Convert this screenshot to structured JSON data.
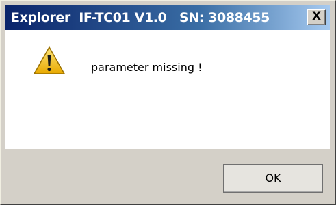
{
  "window": {
    "title": "Explorer  IF-TC01 V1.0   SN: 3088455",
    "close_label": "X"
  },
  "message": {
    "text": "parameter missing !",
    "icon": "warning-icon"
  },
  "buttons": {
    "ok_label": "OK"
  },
  "colors": {
    "title_bar_start": "#0a246a",
    "title_bar_end": "#a6caf0",
    "dialog_face": "#d4d0c8",
    "warning_fill": "#f2c200"
  }
}
